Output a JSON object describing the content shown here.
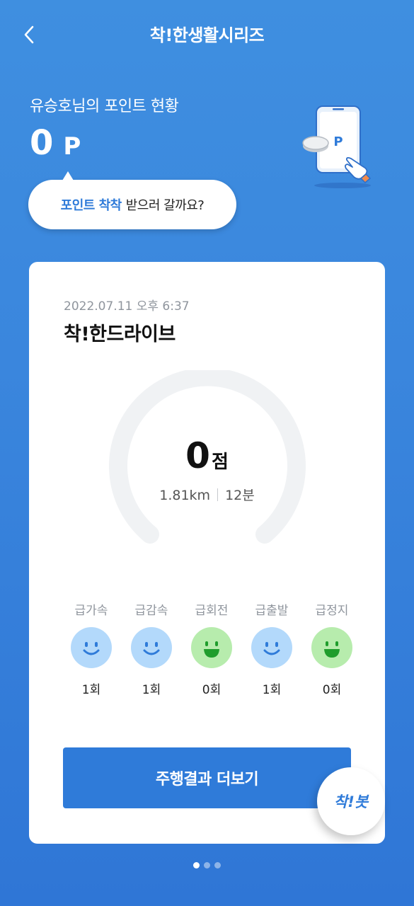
{
  "header": {
    "title": "착!한생활시리즈",
    "back_icon": "chevron-left-icon"
  },
  "points": {
    "label": "유승호님의 포인트 현황",
    "value": "0",
    "unit": "P",
    "illustration": "phone-coin-icon",
    "illustration_letter": "P"
  },
  "bubble": {
    "highlight": "포인트 착착",
    "text": "받으러 갈까요?"
  },
  "card": {
    "date": "2022.07.11 오후 6:37",
    "title": "착!한드라이브",
    "score": "0",
    "score_unit": "점",
    "distance": "1.81km",
    "duration": "12분",
    "metrics": [
      {
        "label": "급가속",
        "count": "1회",
        "face": "blue-smile-icon"
      },
      {
        "label": "급감속",
        "count": "1회",
        "face": "blue-smile-icon"
      },
      {
        "label": "급회전",
        "count": "0회",
        "face": "green-grin-icon"
      },
      {
        "label": "급출발",
        "count": "1회",
        "face": "blue-smile-icon"
      },
      {
        "label": "급정지",
        "count": "0회",
        "face": "green-grin-icon"
      }
    ],
    "more_button": "주행결과 더보기"
  },
  "bot_button": "착!봇",
  "pagination": {
    "total": 3,
    "current": 1
  },
  "colors": {
    "background": "#3a86dd",
    "accent": "#2f7bd9",
    "face_blue": "#b3d9fb",
    "face_green": "#b7ecad"
  }
}
